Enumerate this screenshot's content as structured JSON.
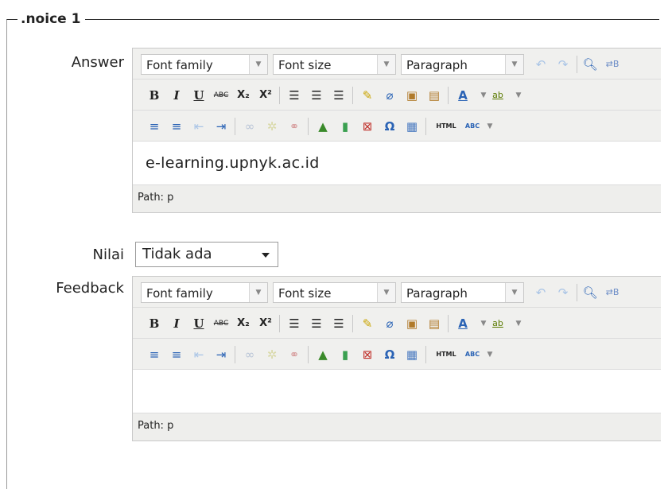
{
  "fieldset": {
    "legend": ".noice 1"
  },
  "answer": {
    "label": "Answer",
    "editor": {
      "font_family": "Font family",
      "font_size": "Font size",
      "format": "Paragraph",
      "content": "e-learning.upnyk.ac.id",
      "path": "Path: p"
    }
  },
  "nilai": {
    "label": "Nilai",
    "value": "Tidak ada"
  },
  "feedback": {
    "label": "Feedback",
    "editor": {
      "font_family": "Font family",
      "font_size": "Font size",
      "format": "Paragraph",
      "content": "",
      "path": "Path: p"
    }
  },
  "toolbar": {
    "bold": "B",
    "italic": "I",
    "underline": "U",
    "strike": "ABC",
    "subscript": "X₂",
    "superscript": "X²",
    "omega": "Ω",
    "html": "HTML",
    "spell": "ABC"
  },
  "colors": {
    "accent_blue": "#2a63b5",
    "border": "#c9c9c9",
    "toolbar_bg": "#f0f0ee"
  }
}
